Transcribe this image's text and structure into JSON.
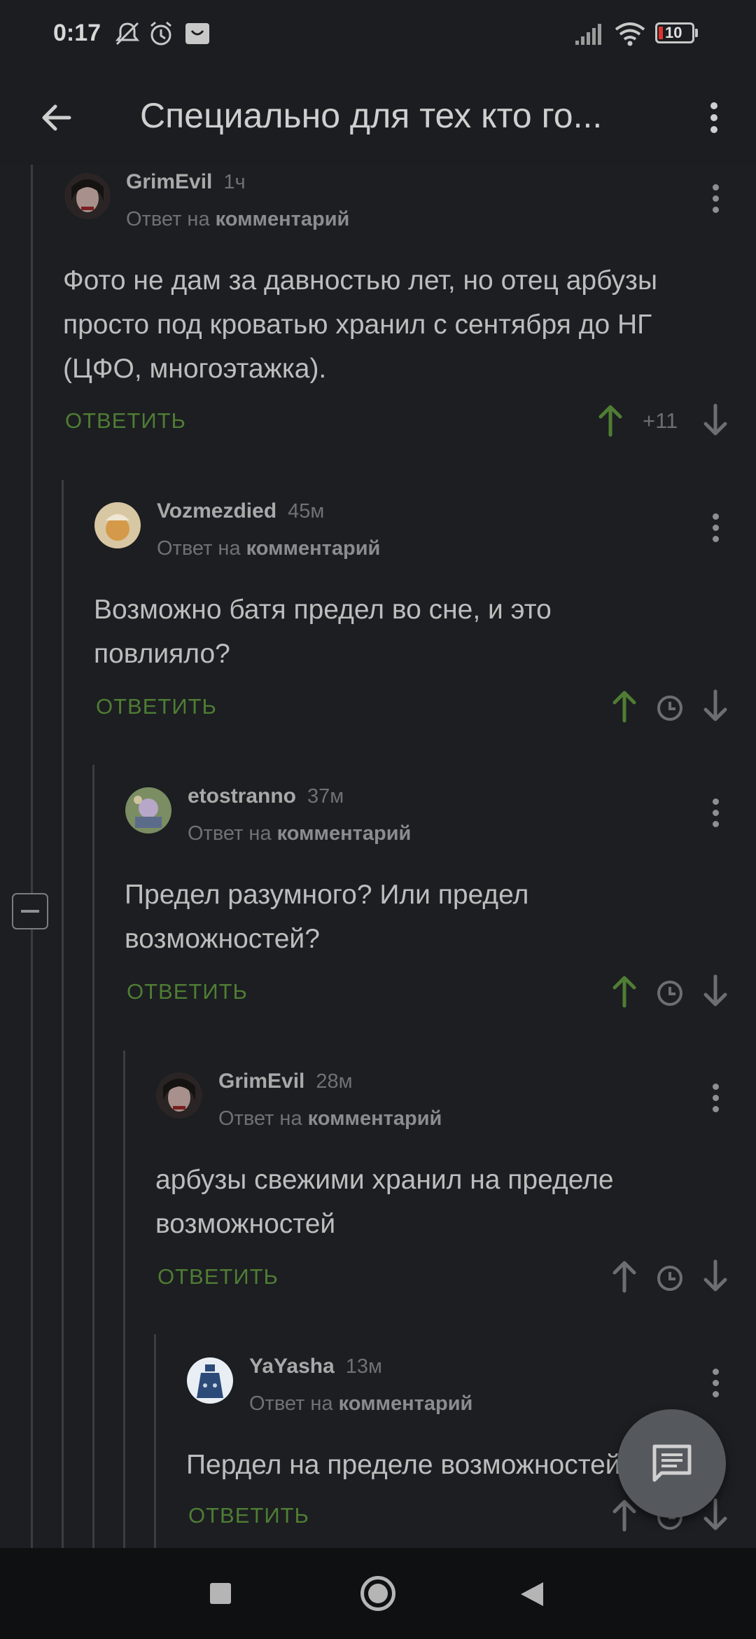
{
  "status": {
    "time": "0:17",
    "battery": "10"
  },
  "appbar": {
    "title": "Специально для тех кто го..."
  },
  "reply_to_prefix": "Ответ на",
  "reply_to_target": "комментарий",
  "comments": [
    {
      "author": "GrimEvil",
      "time": "1ч",
      "body": "Фото не дам за давностью лет, но отец арбузы просто под кроватью хранил с сентября до НГ (ЦФО, многоэтажка).",
      "reply": "ОТВЕТИТЬ",
      "rating": "+11",
      "voted_up": true
    },
    {
      "author": "Vozmezdied",
      "time": "45м",
      "body": "Возможно батя предел во сне, и это повлияло?",
      "reply": "ОТВЕТИТЬ",
      "voted_up": true
    },
    {
      "author": "etostranno",
      "time": "37м",
      "body": "Предел разумного? Или предел возможностей?",
      "reply": "ОТВЕТИТЬ",
      "voted_up": true
    },
    {
      "author": "GrimEvil",
      "time": "28м",
      "body": "арбузы свежими хранил на пределе возможностей",
      "reply": "ОТВЕТИТЬ",
      "voted_up": false
    },
    {
      "author": "YaYasha",
      "time": "13м",
      "body": "Пердел на пределе возможностей",
      "reply": "ОТВЕТИТЬ",
      "voted_up": false
    }
  ],
  "icons": {
    "back": "arrow-left-icon",
    "menu": "more-vert-icon",
    "fab": "comment-icon",
    "nav": [
      "square-icon",
      "circle-icon",
      "triangle-back-icon"
    ]
  },
  "colors": {
    "accent_green": "#4f7d34",
    "background": "#1c1e21"
  }
}
